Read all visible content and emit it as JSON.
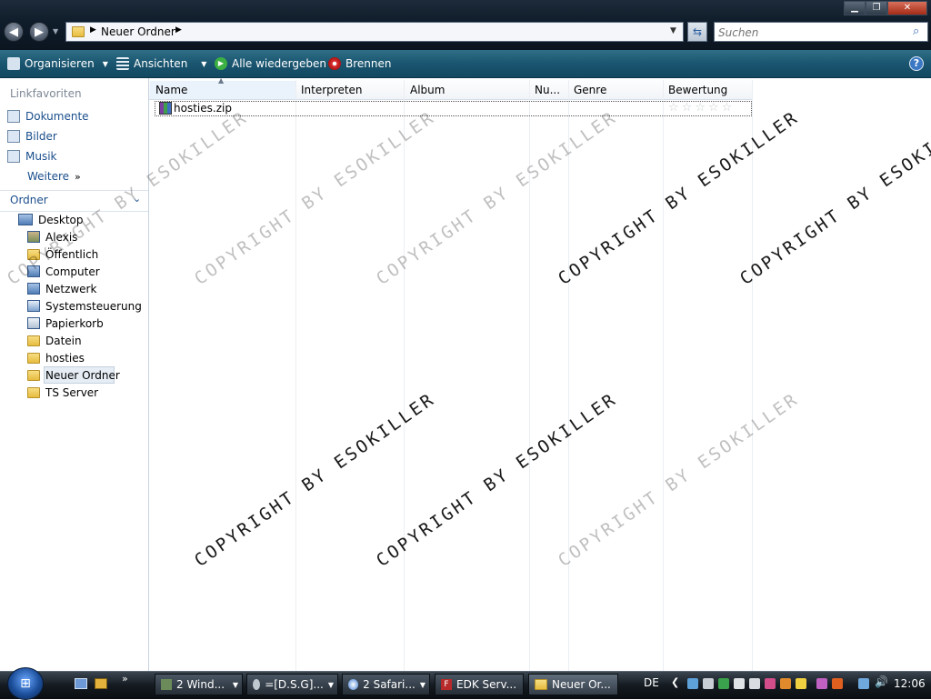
{
  "address": {
    "path": [
      "Neuer Ordner"
    ]
  },
  "search": {
    "placeholder": "Suchen"
  },
  "commandbar": {
    "organize": "Organisieren",
    "views": "Ansichten",
    "play_all": "Alle wiedergeben",
    "burn": "Brennen"
  },
  "nav": {
    "favorites_title": "Linkfavoriten",
    "favorites": [
      "Dokumente",
      "Bilder",
      "Musik"
    ],
    "more": "Weitere",
    "folders_title": "Ordner",
    "tree": [
      "Desktop",
      "Alexis",
      "Öffentlich",
      "Computer",
      "Netzwerk",
      "Systemsteuerung",
      "Papierkorb",
      "Datein",
      "hosties",
      "Neuer Ordner",
      "TS Server"
    ],
    "selected": "Neuer Ordner"
  },
  "columns": [
    "Name",
    "Interpreten",
    "Album",
    "Nu...",
    "Genre",
    "Bewertung"
  ],
  "files": [
    {
      "name": "hosties.zip",
      "rating": 0
    }
  ],
  "watermark": "COPYRIGHT BY ESOKILLER",
  "taskbar": {
    "tasks": [
      "2 Wind...",
      "=[D.S.G]...",
      "2 Safari...",
      "EDK Serv...",
      "Neuer Or..."
    ],
    "language": "DE",
    "clock": "12:06"
  },
  "colors": {
    "cmdbar": "#1a5570",
    "link": "#1a4e8c",
    "taskbar": "#141a20"
  }
}
